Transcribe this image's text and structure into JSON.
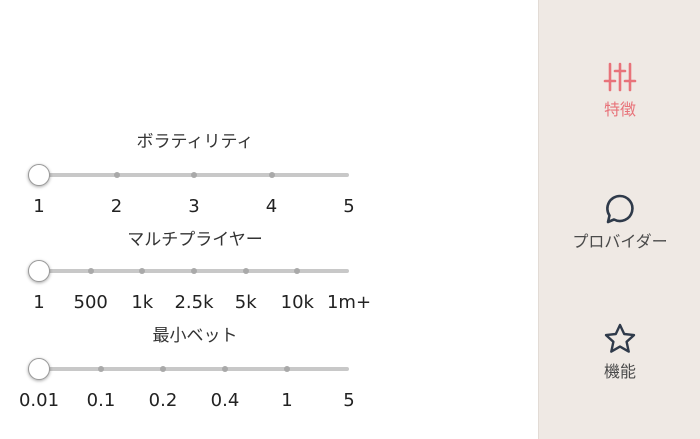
{
  "filters": [
    {
      "title": "ボラティリティ",
      "labels": [
        "1",
        "2",
        "3",
        "4",
        "5"
      ],
      "selected_index": 0
    },
    {
      "title": "マルチプライヤー",
      "labels": [
        "1",
        "500",
        "1k",
        "2.5k",
        "5k",
        "10k",
        "1m+"
      ],
      "selected_index": 0
    },
    {
      "title": "最小ベット",
      "labels": [
        "0.01",
        "0.1",
        "0.2",
        "0.4",
        "1",
        "5"
      ],
      "selected_index": 0
    }
  ],
  "sidebar": {
    "items": [
      {
        "label": "特徴",
        "icon": "sliders-icon",
        "active": true
      },
      {
        "label": "プロバイダー",
        "icon": "speech-bubble-icon",
        "active": false
      },
      {
        "label": "機能",
        "icon": "star-outline-icon",
        "active": false
      }
    ]
  },
  "colors": {
    "accent": "#e8737a",
    "sidebar_bg": "#efe9e4",
    "track": "#c8c8c8",
    "icon_dark": "#2f3a4a"
  }
}
